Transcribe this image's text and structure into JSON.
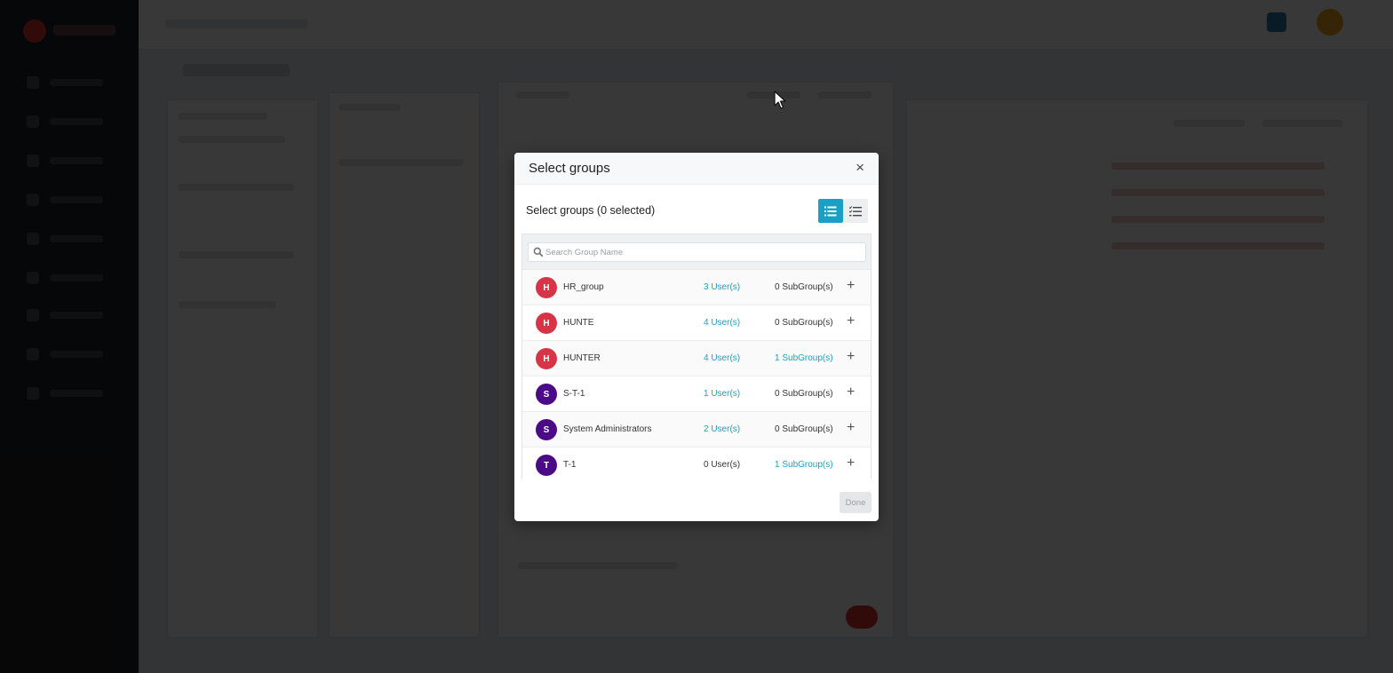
{
  "modal": {
    "title": "Select groups",
    "close_glyph": "×",
    "subtitle": "Select groups (0 selected)",
    "search_placeholder": "Search Group Name",
    "done_label": "Done",
    "view_icons": [
      "list-view-icon",
      "checklist-view-icon"
    ],
    "groups": [
      {
        "initial": "H",
        "name": "HR_group",
        "users": "3 User(s)",
        "users_link": true,
        "subgroups": "0 SubGroup(s)",
        "subgroups_link": false,
        "color": "#d63447"
      },
      {
        "initial": "H",
        "name": "HUNTE",
        "users": "4 User(s)",
        "users_link": true,
        "subgroups": "0 SubGroup(s)",
        "subgroups_link": false,
        "color": "#d63447"
      },
      {
        "initial": "H",
        "name": "HUNTER",
        "users": "4 User(s)",
        "users_link": true,
        "subgroups": "1 SubGroup(s)",
        "subgroups_link": true,
        "color": "#d63447"
      },
      {
        "initial": "S",
        "name": "S-T-1",
        "users": "1 User(s)",
        "users_link": true,
        "subgroups": "0 SubGroup(s)",
        "subgroups_link": false,
        "color": "#4b0a86"
      },
      {
        "initial": "S",
        "name": "System Administrators",
        "users": "2 User(s)",
        "users_link": true,
        "subgroups": "0 SubGroup(s)",
        "subgroups_link": false,
        "color": "#4b0a86"
      },
      {
        "initial": "T",
        "name": "T-1",
        "users": "0 User(s)",
        "users_link": false,
        "subgroups": "1 SubGroup(s)",
        "subgroups_link": true,
        "color": "#4b0a86"
      }
    ],
    "add_glyph": "+"
  },
  "colors": {
    "accent": "#1aa0c6",
    "avatar_red": "#d63447",
    "avatar_purple": "#4b0a86"
  }
}
